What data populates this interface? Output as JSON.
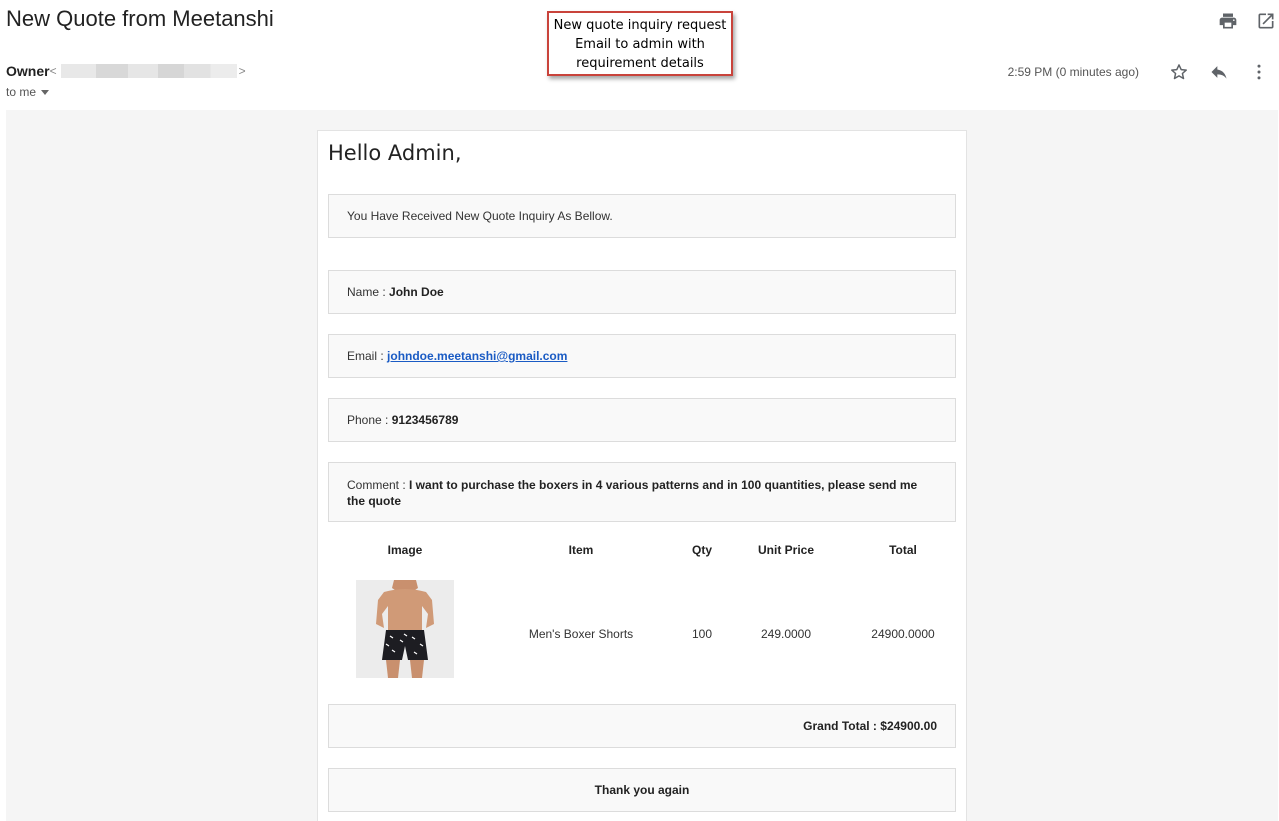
{
  "email": {
    "subject": "New Quote from Meetanshi",
    "sender_name": "Owner",
    "sender_lt": "<",
    "sender_gt": ">",
    "recipient": "to me",
    "time": "2:59 PM (0 minutes ago)"
  },
  "callout": {
    "line1": "New quote inquiry request",
    "line2": "Email to admin with",
    "line3": "requirement details"
  },
  "body": {
    "greeting": "Hello Admin,",
    "intro": "You Have Received New Quote Inquiry As Bellow.",
    "name_label": "Name : ",
    "name_value": "John Doe",
    "email_label": "Email : ",
    "email_value": "johndoe.meetanshi@gmail.com",
    "phone_label": "Phone : ",
    "phone_value": "9123456789",
    "comment_label": "Comment : ",
    "comment_value": "I want to purchase the boxers in 4 various patterns and in 100 quantities, please send me the quote",
    "table": {
      "headers": [
        "Image",
        "Item",
        "Qty",
        "Unit Price",
        "Total"
      ],
      "row": {
        "item": "Men's Boxer Shorts",
        "qty": "100",
        "unit_price": "249.0000",
        "total": "24900.0000"
      }
    },
    "grand_total": "Grand Total : $24900.00",
    "thanks": "Thank you again"
  },
  "icons": [
    "print-icon",
    "open-in-new-window-icon",
    "star-icon",
    "reply-icon",
    "more-vert-icon",
    "dropdown-caret-icon",
    "product-image"
  ],
  "colors": {
    "link": "#1a5bc4",
    "callout_border": "#c9433b",
    "canvas_bg": "#f5f5f5"
  }
}
